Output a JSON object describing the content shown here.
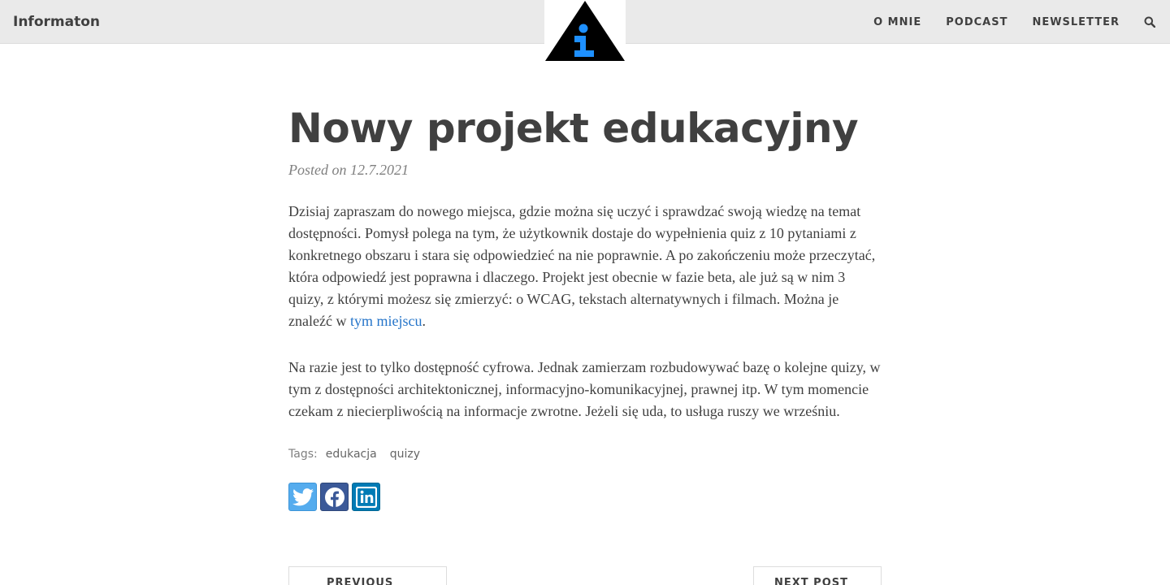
{
  "site": {
    "name": "Informaton"
  },
  "nav": {
    "items": [
      {
        "label": "O MNIE"
      },
      {
        "label": "PODCAST"
      },
      {
        "label": "NEWSLETTER"
      }
    ],
    "search_icon": "search-icon"
  },
  "logo": {
    "icon": "info-triangle-logo",
    "colors": {
      "triangle": "#000000",
      "glyph": "#1e90ff"
    }
  },
  "post": {
    "title": "Nowy projekt edukacyjny",
    "meta": "Posted on 12.7.2021",
    "p1_text": "Dzisiaj zapraszam do nowego miejsca, gdzie można się uczyć i sprawdzać swoją wiedzę na temat dostępności. Pomysł polega na tym, że użytkownik dostaje do wypełnienia quiz z 10 pytaniami z konkretnego obszaru i stara się odpowiedzieć na nie poprawnie. A po zakończeniu może przeczytać, która odpowiedź jest poprawna i dlaczego. Projekt jest obecnie w fazie beta, ale już są w nim 3 quizy, z którymi możesz się zmierzyć: o WCAG, tekstach alternatywnych i filmach. Można je znaleźć w ",
    "p1_link": "tym miejscu",
    "p1_end": ".",
    "p2_text": "Na razie jest to tylko dostępność cyfrowa. Jednak zamierzam rozbudowywać bazę o kolejne quizy, w tym z dostępności architektonicznej, informacyjno-komunikacyjnej, prawnej itp. W tym momencie czekam z niecierpliwością na informacje zwrotne. Jeżeli się uda, to usługa ruszy we wrześniu."
  },
  "tags": {
    "label": "Tags:",
    "items": [
      "edukacja",
      "quizy"
    ]
  },
  "share": {
    "buttons": [
      {
        "icon": "twitter-icon",
        "color": "#55acee"
      },
      {
        "icon": "facebook-icon",
        "color": "#3b5998"
      },
      {
        "icon": "linkedin-icon",
        "color": "#007bb5"
      }
    ]
  },
  "pager": {
    "prev_label": "PREVIOUS POST",
    "next_label": "NEXT POST"
  }
}
